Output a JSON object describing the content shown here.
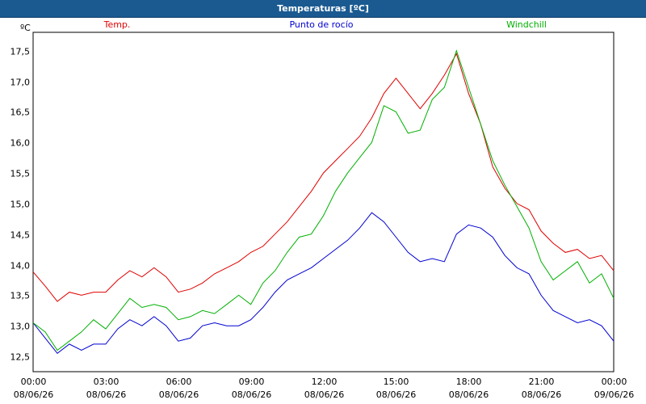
{
  "window": {
    "title": "Temperaturas [ºC]"
  },
  "chart_data": {
    "type": "line",
    "title": "Temperaturas [ºC]",
    "ylabel": "ºC",
    "ylim": [
      12.25,
      17.8
    ],
    "yticks": [
      "12,5",
      "13,0",
      "13,5",
      "14,0",
      "14,5",
      "15,0",
      "15,5",
      "16,0",
      "16,5",
      "17,0",
      "17,5"
    ],
    "ytick_values": [
      12.5,
      13.0,
      13.5,
      14.0,
      14.5,
      15.0,
      15.5,
      16.0,
      16.5,
      17.0,
      17.5
    ],
    "xlim": [
      0,
      24
    ],
    "xticks": [
      {
        "x": 0,
        "time": "00:00",
        "date": "08/06/26"
      },
      {
        "x": 3,
        "time": "03:00",
        "date": "08/06/26"
      },
      {
        "x": 6,
        "time": "06:00",
        "date": "08/06/26"
      },
      {
        "x": 9,
        "time": "09:00",
        "date": "08/06/26"
      },
      {
        "x": 12,
        "time": "12:00",
        "date": "08/06/26"
      },
      {
        "x": 15,
        "time": "15:00",
        "date": "08/06/26"
      },
      {
        "x": 18,
        "time": "18:00",
        "date": "08/06/26"
      },
      {
        "x": 21,
        "time": "21:00",
        "date": "08/06/26"
      },
      {
        "x": 24,
        "time": "00:00",
        "date": "09/06/26"
      }
    ],
    "grid": true,
    "legend_position": "top",
    "series": [
      {
        "name": "Temp.",
        "color": "#e00000",
        "x": [
          0,
          0.5,
          1,
          1.5,
          2,
          2.5,
          3,
          3.5,
          4,
          4.5,
          5,
          5.5,
          6,
          6.5,
          7,
          7.5,
          8,
          8.5,
          9,
          9.5,
          10,
          10.5,
          11,
          11.5,
          12,
          12.5,
          13,
          13.5,
          14,
          14.5,
          15,
          15.5,
          16,
          16.5,
          17,
          17.5,
          18,
          18.5,
          19,
          19.5,
          20,
          20.5,
          21,
          21.5,
          22,
          22.5,
          23,
          23.5,
          24
        ],
        "values": [
          13.88,
          13.65,
          13.4,
          13.55,
          13.5,
          13.55,
          13.55,
          13.75,
          13.9,
          13.8,
          13.95,
          13.8,
          13.55,
          13.6,
          13.7,
          13.85,
          13.95,
          14.05,
          14.2,
          14.3,
          14.5,
          14.7,
          14.95,
          15.2,
          15.5,
          15.7,
          15.9,
          16.1,
          16.4,
          16.8,
          17.05,
          16.8,
          16.55,
          16.8,
          17.1,
          17.45,
          16.8,
          16.3,
          15.6,
          15.25,
          15.0,
          14.9,
          14.55,
          14.35,
          14.2,
          14.25,
          14.1,
          14.15,
          13.9
        ]
      },
      {
        "name": "Punto de rocío",
        "color": "#0000d0",
        "x": [
          0,
          0.5,
          1,
          1.5,
          2,
          2.5,
          3,
          3.5,
          4,
          4.5,
          5,
          5.5,
          6,
          6.5,
          7,
          7.5,
          8,
          8.5,
          9,
          9.5,
          10,
          10.5,
          11,
          11.5,
          12,
          12.5,
          13,
          13.5,
          14,
          14.5,
          15,
          15.5,
          16,
          16.5,
          17,
          17.5,
          18,
          18.5,
          19,
          19.5,
          20,
          20.5,
          21,
          21.5,
          22,
          22.5,
          23,
          23.5,
          24
        ],
        "values": [
          13.05,
          12.8,
          12.55,
          12.7,
          12.6,
          12.7,
          12.7,
          12.95,
          13.1,
          13.0,
          13.15,
          13.0,
          12.75,
          12.8,
          13.0,
          13.05,
          13.0,
          13.0,
          13.1,
          13.3,
          13.55,
          13.75,
          13.85,
          13.95,
          14.1,
          14.25,
          14.4,
          14.6,
          14.85,
          14.7,
          14.45,
          14.2,
          14.05,
          14.1,
          14.05,
          14.5,
          14.65,
          14.6,
          14.45,
          14.15,
          13.95,
          13.85,
          13.5,
          13.25,
          13.15,
          13.05,
          13.1,
          13.0,
          12.75
        ]
      },
      {
        "name": "Windchill",
        "color": "#00b000",
        "x": [
          0,
          0.5,
          1,
          1.5,
          2,
          2.5,
          3,
          3.5,
          4,
          4.5,
          5,
          5.5,
          6,
          6.5,
          7,
          7.5,
          8,
          8.5,
          9,
          9.5,
          10,
          10.5,
          11,
          11.5,
          12,
          12.5,
          13,
          13.5,
          14,
          14.5,
          15,
          15.5,
          16,
          16.5,
          17,
          17.5,
          18,
          18.5,
          19,
          19.5,
          20,
          20.5,
          21,
          21.5,
          22,
          22.5,
          23,
          23.5,
          24
        ],
        "values": [
          13.05,
          12.9,
          12.6,
          12.75,
          12.9,
          13.1,
          12.95,
          13.2,
          13.45,
          13.3,
          13.35,
          13.3,
          13.1,
          13.15,
          13.25,
          13.2,
          13.35,
          13.5,
          13.35,
          13.7,
          13.9,
          14.2,
          14.45,
          14.5,
          14.8,
          15.2,
          15.5,
          15.75,
          16.0,
          16.6,
          16.5,
          16.15,
          16.2,
          16.7,
          16.9,
          17.5,
          16.9,
          16.3,
          15.7,
          15.3,
          14.95,
          14.6,
          14.05,
          13.75,
          13.9,
          14.05,
          13.7,
          13.85,
          13.45
        ]
      }
    ]
  }
}
